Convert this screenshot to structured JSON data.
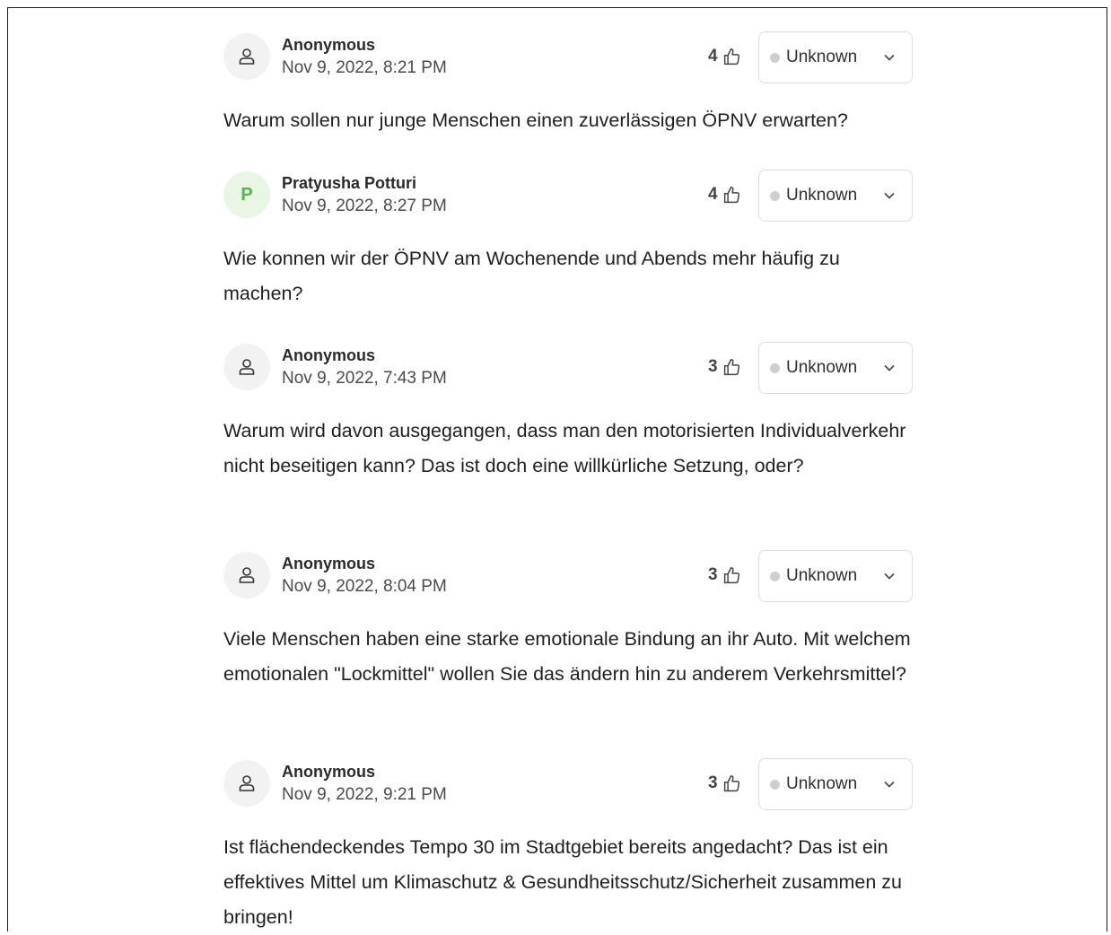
{
  "questions": [
    {
      "author": "Anonymous",
      "avatar_type": "user-icon",
      "timestamp": "Nov 9, 2022, 8:21 PM",
      "votes": "4",
      "status": "Unknown",
      "text": "Warum sollen nur junge Menschen einen zuverlässigen ÖPNV erwarten?"
    },
    {
      "author": "Pratyusha Potturi",
      "avatar_type": "initial",
      "avatar_initial": "P",
      "avatar_color": "#56b44a",
      "timestamp": "Nov 9, 2022, 8:27 PM",
      "votes": "4",
      "status": "Unknown",
      "text": "Wie konnen wir der ÖPNV am Wochenende und Abends mehr häufig zu machen?"
    },
    {
      "author": "Anonymous",
      "avatar_type": "user-icon",
      "timestamp": "Nov 9, 2022, 7:43 PM",
      "votes": "3",
      "status": "Unknown",
      "text": "Warum wird davon ausgegangen, dass man den motorisierten Individualverkehr nicht beseitigen kann? Das ist doch eine willkürliche Setzung, oder?"
    },
    {
      "author": "Anonymous",
      "avatar_type": "user-icon",
      "timestamp": "Nov 9, 2022, 8:04 PM",
      "votes": "3",
      "status": "Unknown",
      "text": "Viele Menschen haben eine starke emotionale Bindung an ihr Auto. Mit welchem emotionalen \"Lockmittel\" wollen Sie das ändern hin zu anderem Verkehrsmittel?"
    },
    {
      "author": "Anonymous",
      "avatar_type": "user-icon",
      "timestamp": "Nov 9, 2022, 9:21 PM",
      "votes": "3",
      "status": "Unknown",
      "text": "Ist flächendeckendes Tempo 30 im Stadtgebiet bereits angedacht? Das ist ein effektives Mittel um Klimaschutz & Gesundheitsschutz/Sicherheit zusammen zu bringen!"
    }
  ],
  "icons": {
    "upvote": "thumbs-up-icon",
    "status_dropdown": "chevron-down-icon",
    "anonymous_avatar": "user-icon"
  },
  "colors": {
    "status_dot": "#cfcfcf",
    "initial_avatar_bg": "#e9f6e6"
  }
}
